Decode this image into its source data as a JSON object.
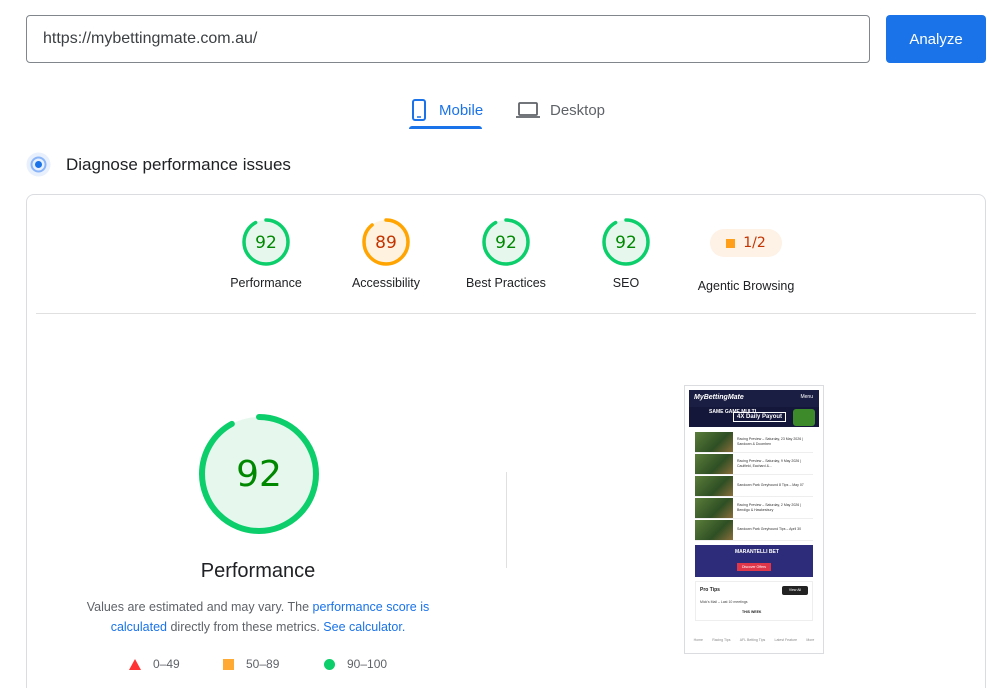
{
  "search": {
    "url_value": "https://mybettingmate.com.au/",
    "analyze_label": "Analyze"
  },
  "tabs": [
    {
      "label": "Mobile",
      "active": true,
      "icon": "smartphone-icon"
    },
    {
      "label": "Desktop",
      "active": false,
      "icon": "laptop-icon"
    }
  ],
  "diagnose": {
    "title": "Diagnose performance issues",
    "icon": "lighthouse-icon"
  },
  "categories": [
    {
      "label": "Performance",
      "score": "92",
      "status": "pass"
    },
    {
      "label": "Accessibility",
      "score": "89",
      "status": "average"
    },
    {
      "label": "Best Practices",
      "score": "92",
      "status": "pass"
    },
    {
      "label": "SEO",
      "score": "92",
      "status": "pass"
    },
    {
      "label": "Agentic Browsing",
      "score": "1/2",
      "status": "average"
    }
  ],
  "colors": {
    "pass": "#0cce6b",
    "pass_text": "#008800",
    "pass_fill": "#e6f8ee",
    "average": "#ffa400",
    "average_text": "#c33300",
    "average_fill": "#fff3e0",
    "fail": "#ff3333",
    "accent": "#1a73e8"
  },
  "performance": {
    "score": "92",
    "title": "Performance",
    "desc_prefix": "Values are estimated and may vary. The",
    "desc_link1": "performance score is calculated",
    "desc_middle": "directly from these metrics.",
    "desc_link2": "See calculator."
  },
  "legend": [
    {
      "range": "0–49",
      "shape": "triangle"
    },
    {
      "range": "50–89",
      "shape": "square"
    },
    {
      "range": "90–100",
      "shape": "circle"
    }
  ],
  "thumbnail": {
    "brand": "MyBettingMate",
    "menu": "Menu",
    "banner_text": "SAME GAME MULTI",
    "banner_offer": "4X Daily Payout",
    "articles": [
      "Racing Preview – Saturday, 23 May 2026 | Sandown & Doomben",
      "Racing Preview – Saturday, 9 May 2026 | Caulfield, Eachard &...",
      "Sandown Park Greyhound 8 Tips – May 07",
      "Racing Preview – Saturday, 2 May 2026 | Bendigo & Hawkesbury",
      "Sandown Park Greyhound Tips – April 30"
    ],
    "ad_brand": "MARANTELLI BET",
    "ad_button": "Discover Offers",
    "tips_title": "Pro Tips",
    "tips_button": "View All",
    "tips_row": "Mick's Mail – Last 10 meetings",
    "tips_week": "THIS WEEK",
    "nav": [
      "Home",
      "Racing Tips",
      "AFL Betting Tips",
      "Latest Feature",
      "More"
    ]
  }
}
